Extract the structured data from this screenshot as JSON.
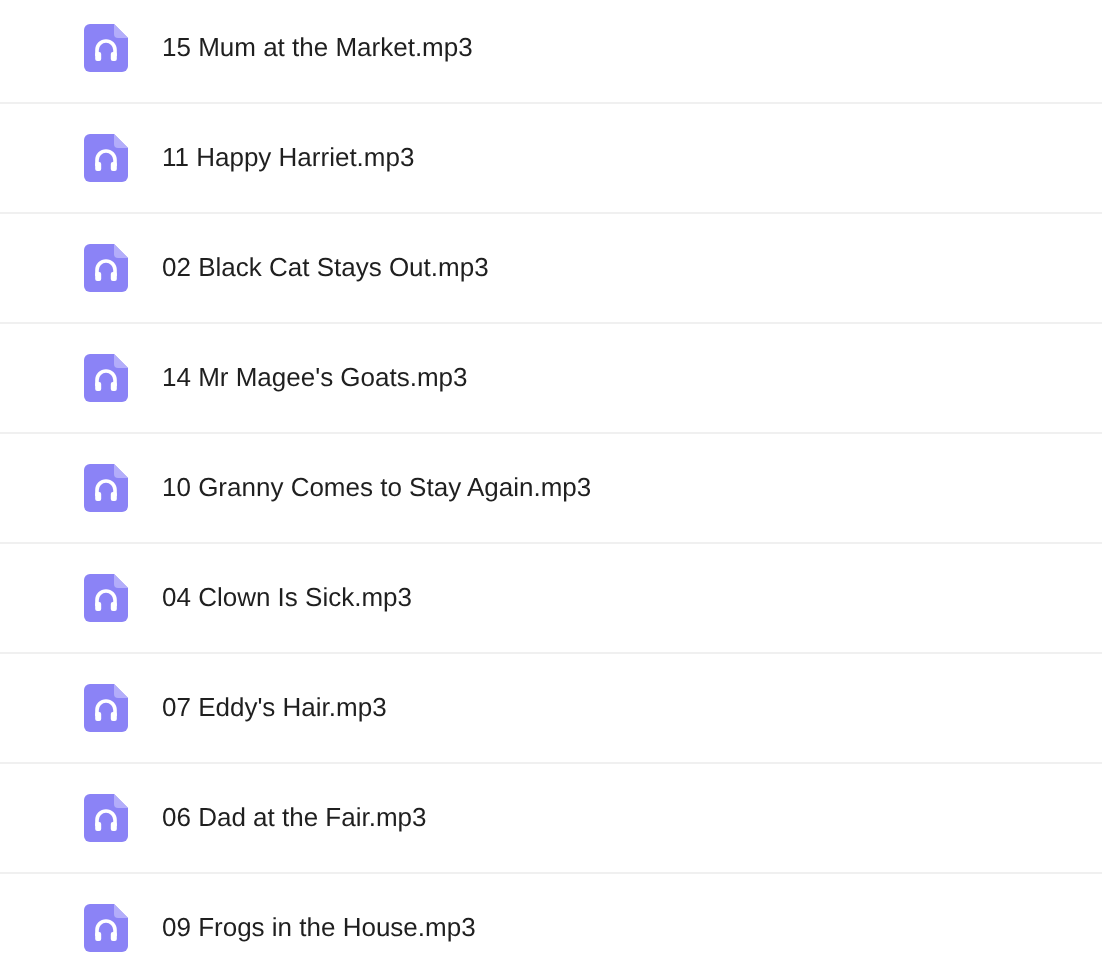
{
  "files": [
    {
      "name": "15 Mum at the Market.mp3"
    },
    {
      "name": "11 Happy Harriet.mp3"
    },
    {
      "name": "02 Black Cat Stays Out.mp3"
    },
    {
      "name": "14 Mr Magee's Goats.mp3"
    },
    {
      "name": "10 Granny Comes to Stay Again.mp3"
    },
    {
      "name": "04 Clown Is Sick.mp3"
    },
    {
      "name": "07 Eddy's Hair.mp3"
    },
    {
      "name": "06 Dad at the Fair.mp3"
    },
    {
      "name": "09 Frogs in the House.mp3"
    }
  ]
}
